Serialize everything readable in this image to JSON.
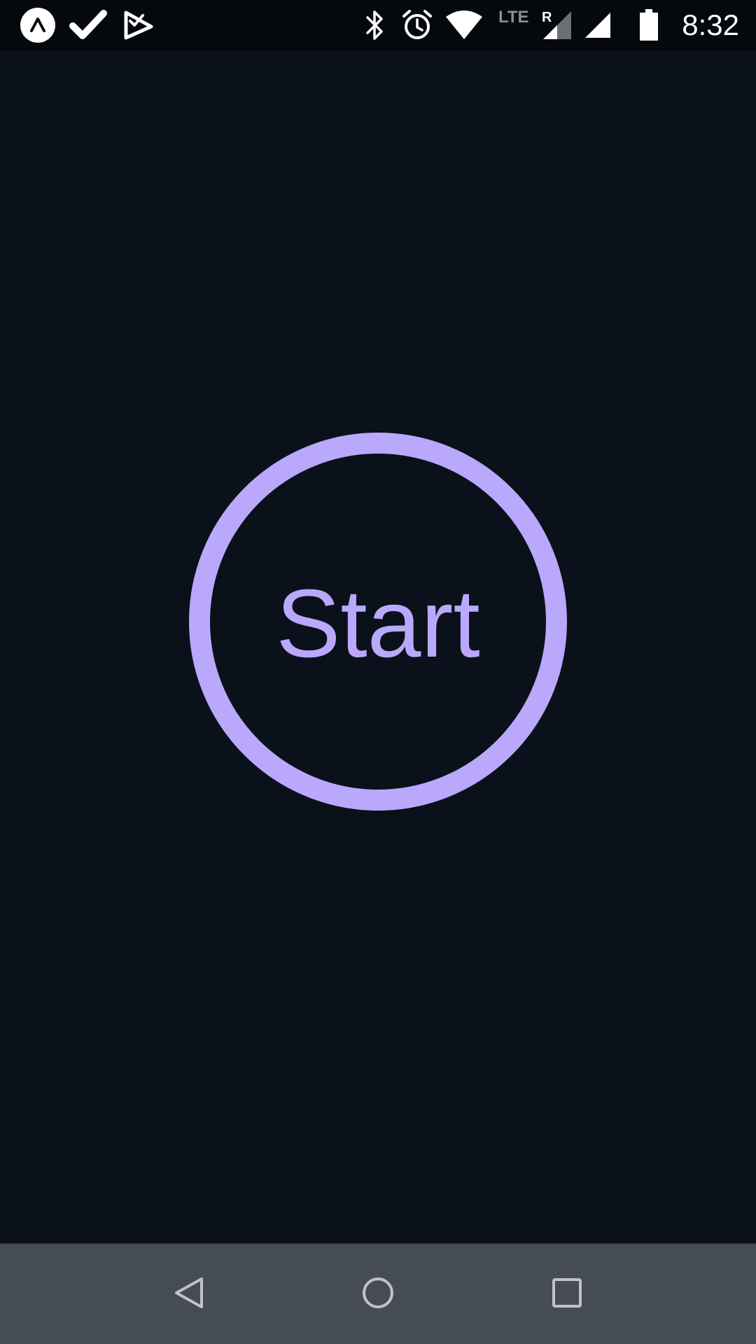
{
  "status_bar": {
    "time": "8:32",
    "left_icons": [
      "launcher-icon",
      "check-icon",
      "checklist-icon"
    ],
    "right_icons": [
      "bluetooth-icon",
      "alarm-icon",
      "wifi-icon",
      "lte-signal-icon",
      "cell-signal-icon",
      "battery-icon"
    ],
    "lte_label": "LTE",
    "roaming_label": "R"
  },
  "main": {
    "start_label": "Start",
    "accent_color": "#b9a8fb",
    "background_color": "#0a111a"
  },
  "nav_bar": {
    "buttons": [
      "back-icon",
      "home-icon",
      "recents-icon"
    ],
    "background_color": "#454c53"
  }
}
